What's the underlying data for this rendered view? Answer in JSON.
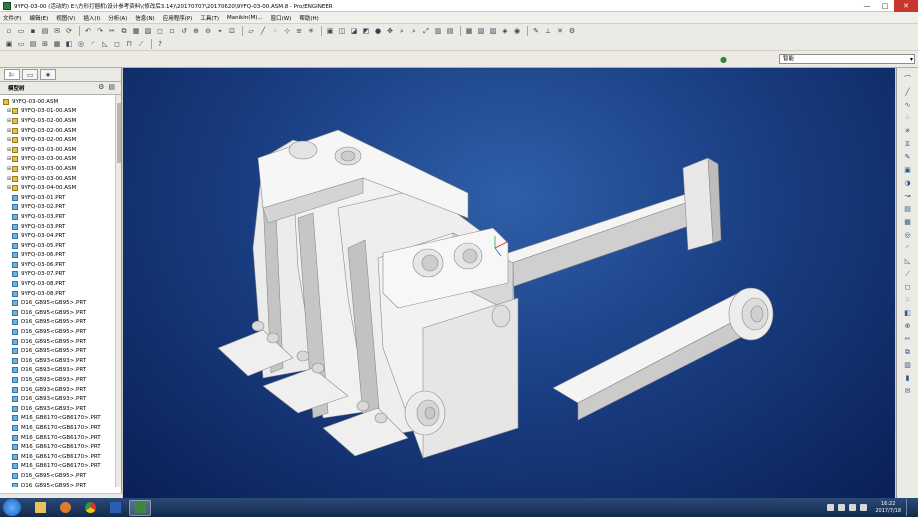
{
  "window": {
    "title": "9YFQ-03-00 (活动的) E:\\方形打捆机\\设计参考资料\\(修改后3.14)\\20170707\\20170620\\9YFQ-03-00.ASM.8 - Pro/ENGINEER",
    "minimize": "—",
    "maximize": "□",
    "close": "✕"
  },
  "menu": {
    "items": [
      "文件(F)",
      "编辑(E)",
      "视图(V)",
      "插入(I)",
      "分析(A)",
      "信息(N)",
      "应用程序(P)",
      "工具(T)",
      "Manikin(M)...",
      "窗口(W)",
      "帮助(H)"
    ]
  },
  "filter": {
    "value": "智能"
  },
  "model_tree": {
    "title": "模型树",
    "root": "9YFQ-03-00.ASM",
    "nodes": [
      {
        "label": "9YFQ-03-01-00.ASM",
        "type": "asm"
      },
      {
        "label": "9YFQ-03-02-00.ASM",
        "type": "asm"
      },
      {
        "label": "9YFQ-03-02-00.ASM",
        "type": "asm"
      },
      {
        "label": "9YFQ-03-02-00.ASM",
        "type": "asm"
      },
      {
        "label": "9YFQ-03-03-00.ASM",
        "type": "asm"
      },
      {
        "label": "9YFQ-03-03-00.ASM",
        "type": "asm"
      },
      {
        "label": "9YFQ-03-03-00.ASM",
        "type": "asm"
      },
      {
        "label": "9YFQ-03-03-00.ASM",
        "type": "asm"
      },
      {
        "label": "9YFQ-03-04-00.ASM",
        "type": "asm"
      },
      {
        "label": "9YFQ-03-01.PRT",
        "type": "prt"
      },
      {
        "label": "9YFQ-03-02.PRT",
        "type": "prt"
      },
      {
        "label": "9YFQ-03-03.PRT",
        "type": "prt"
      },
      {
        "label": "9YFQ-03-03.PRT",
        "type": "prt"
      },
      {
        "label": "9YFQ-03-04.PRT",
        "type": "prt"
      },
      {
        "label": "9YFQ-03-05.PRT",
        "type": "prt"
      },
      {
        "label": "9YFQ-03-06.PRT",
        "type": "prt"
      },
      {
        "label": "9YFQ-03-06.PRT",
        "type": "prt"
      },
      {
        "label": "9YFQ-03-07.PRT",
        "type": "prt"
      },
      {
        "label": "9YFQ-03-08.PRT",
        "type": "prt"
      },
      {
        "label": "9YFQ-03-08.PRT",
        "type": "prt"
      },
      {
        "label": "D16_GB95<GB95>.PRT",
        "type": "prt"
      },
      {
        "label": "D16_GB95<GB95>.PRT",
        "type": "prt"
      },
      {
        "label": "D16_GB95<GB95>.PRT",
        "type": "prt"
      },
      {
        "label": "D16_GB95<GB95>.PRT",
        "type": "prt"
      },
      {
        "label": "D16_GB95<GB95>.PRT",
        "type": "prt"
      },
      {
        "label": "D16_GB95<GB95>.PRT",
        "type": "prt"
      },
      {
        "label": "D16_GB93<GB93>.PRT",
        "type": "prt"
      },
      {
        "label": "D16_GB93<GB93>.PRT",
        "type": "prt"
      },
      {
        "label": "D16_GB93<GB93>.PRT",
        "type": "prt"
      },
      {
        "label": "D16_GB93<GB93>.PRT",
        "type": "prt"
      },
      {
        "label": "D16_GB93<GB93>.PRT",
        "type": "prt"
      },
      {
        "label": "D16_GB93<GB93>.PRT",
        "type": "prt"
      },
      {
        "label": "M16_GB6170<GB6170>.PRT",
        "type": "prt"
      },
      {
        "label": "M16_GB6170<GB6170>.PRT",
        "type": "prt"
      },
      {
        "label": "M16_GB6170<GB6170>.PRT",
        "type": "prt"
      },
      {
        "label": "M16_GB6170<GB6170>.PRT",
        "type": "prt"
      },
      {
        "label": "M16_GB6170<GB6170>.PRT",
        "type": "prt"
      },
      {
        "label": "M16_GB6170<GB6170>.PRT",
        "type": "prt"
      },
      {
        "label": "D16_GB95<GB95>.PRT",
        "type": "prt"
      },
      {
        "label": "D16_GB95<GB95>.PRT",
        "type": "prt"
      }
    ]
  },
  "taskbar": {
    "time": "16:22",
    "date": "2017/7/18"
  },
  "colors": {
    "viewport_center": "#2f5fa8",
    "viewport_edge": "#0a1f55",
    "model_fill": "#f2f2f2",
    "model_shadow": "#c9c9c9",
    "model_edge": "#8a8a8a"
  }
}
